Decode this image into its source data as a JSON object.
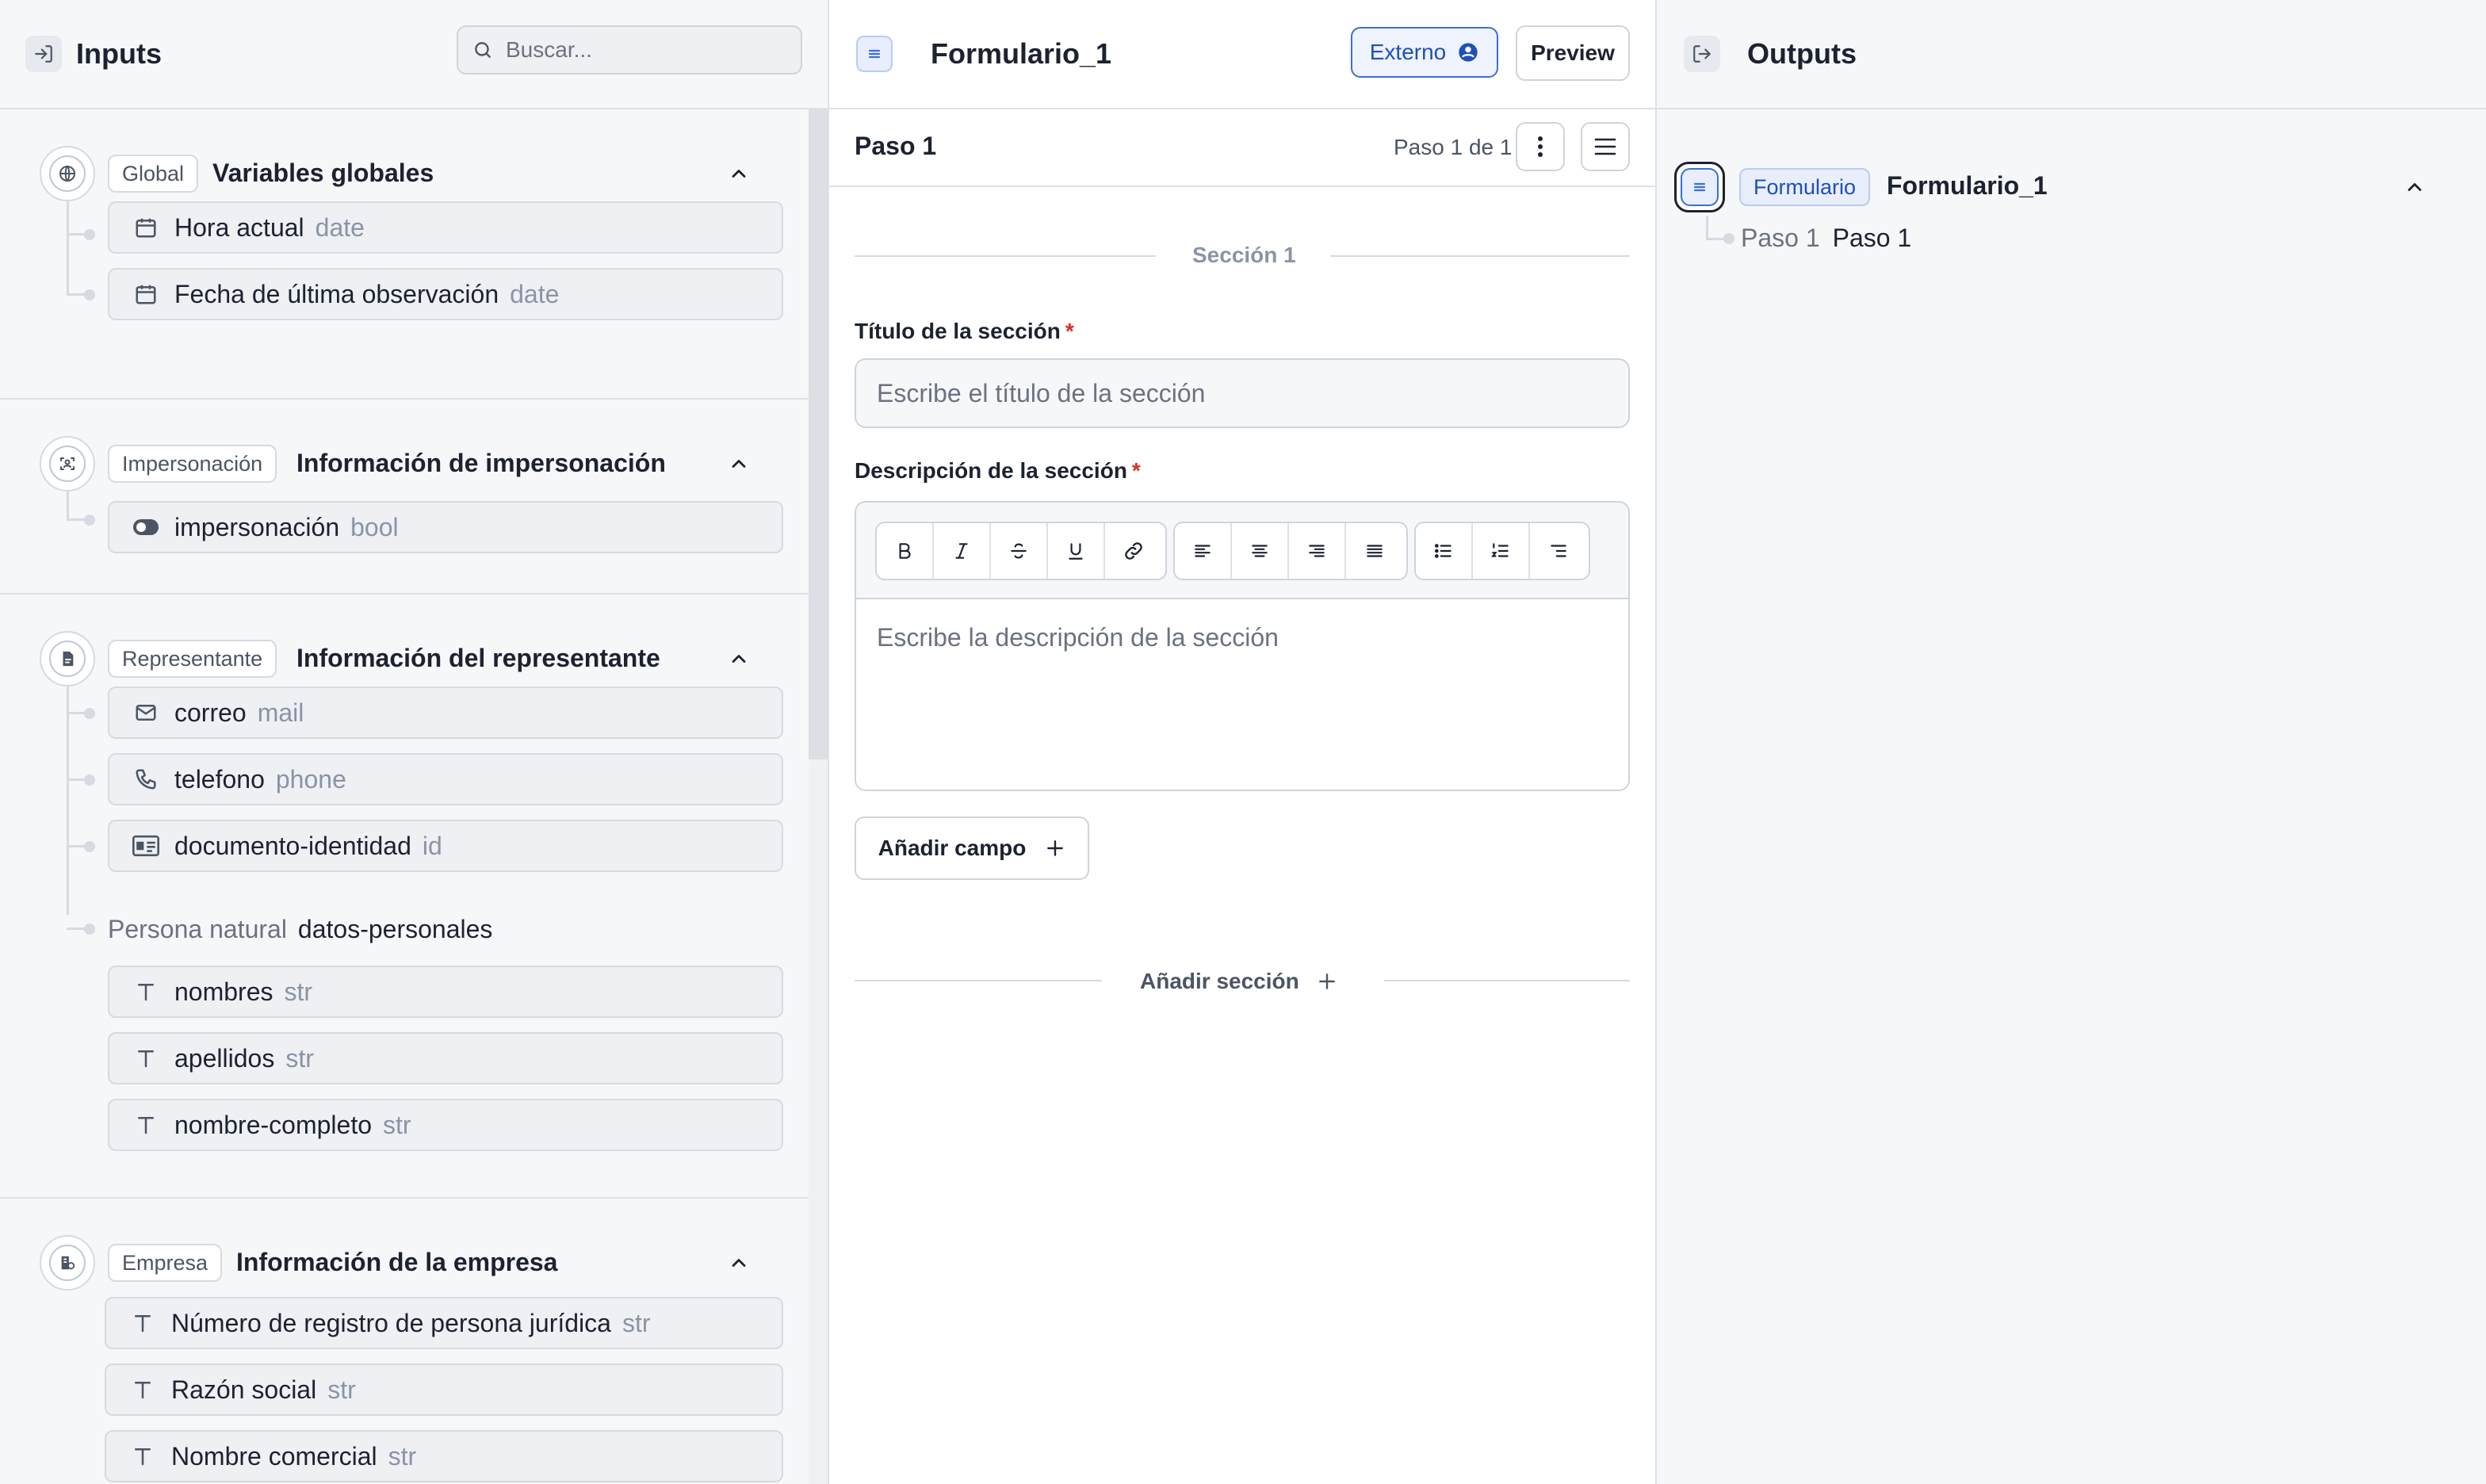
{
  "inputs_panel": {
    "title": "Inputs",
    "search_placeholder": "Buscar...",
    "groups": [
      {
        "tag": "Global",
        "title": "Variables globales",
        "fields": [
          {
            "name": "Hora actual",
            "type": "date",
            "icon": "calendar-icon"
          },
          {
            "name": "Fecha de última observación",
            "type": "date",
            "icon": "calendar-icon"
          }
        ]
      },
      {
        "tag": "Impersonación",
        "title": "Información de impersonación",
        "fields": [
          {
            "name": "impersonación",
            "type": "bool",
            "icon": "toggle-icon"
          }
        ]
      },
      {
        "tag": "Representante",
        "title": "Información del representante",
        "fields": [
          {
            "name": "correo",
            "type": "mail",
            "icon": "mail-icon"
          },
          {
            "name": "telefono",
            "type": "phone",
            "icon": "phone-icon"
          },
          {
            "name": "documento-identidad",
            "type": "id",
            "icon": "id-card-icon"
          }
        ],
        "subgroup": {
          "label": "Persona natural",
          "name": "datos-personales",
          "fields": [
            {
              "name": "nombres",
              "type": "str",
              "icon": "text-icon"
            },
            {
              "name": "apellidos",
              "type": "str",
              "icon": "text-icon"
            },
            {
              "name": "nombre-completo",
              "type": "str",
              "icon": "text-icon"
            }
          ]
        }
      },
      {
        "tag": "Empresa",
        "title": "Información de la empresa",
        "fields": [
          {
            "name": "Número de registro de persona jurídica",
            "type": "str",
            "icon": "text-icon"
          },
          {
            "name": "Razón social",
            "type": "str",
            "icon": "text-icon"
          },
          {
            "name": "Nombre comercial",
            "type": "str",
            "icon": "text-icon"
          }
        ]
      }
    ]
  },
  "editor": {
    "form_name": "Formulario_1",
    "externo_label": "Externo",
    "preview_label": "Preview",
    "step_title": "Paso 1",
    "step_counter": "Paso 1 de 1",
    "section_label": "Sección 1",
    "section_title_label": "Título de la sección",
    "section_title_placeholder": "Escribe el título de la sección",
    "section_desc_label": "Descripción de la sección",
    "section_desc_placeholder": "Escribe la descripción de la sección",
    "required_mark": "*",
    "add_field_label": "Añadir campo",
    "add_section_label": "Añadir sección",
    "toolbar": [
      "bold-icon",
      "italic-icon",
      "strikethrough-icon",
      "underline-icon",
      "link-icon",
      "align-left-icon",
      "align-center-icon",
      "align-right-icon",
      "align-justify-icon",
      "bullet-list-icon",
      "numbered-list-icon",
      "indent-icon"
    ]
  },
  "outputs_panel": {
    "title": "Outputs",
    "form_tag": "Formulario",
    "form_name": "Formulario_1",
    "step_tag": "Paso 1",
    "step_name": "Paso 1"
  },
  "colors": {
    "accent": "#3b6fd8",
    "required": "#d92d20",
    "muted": "#8a94a6"
  }
}
